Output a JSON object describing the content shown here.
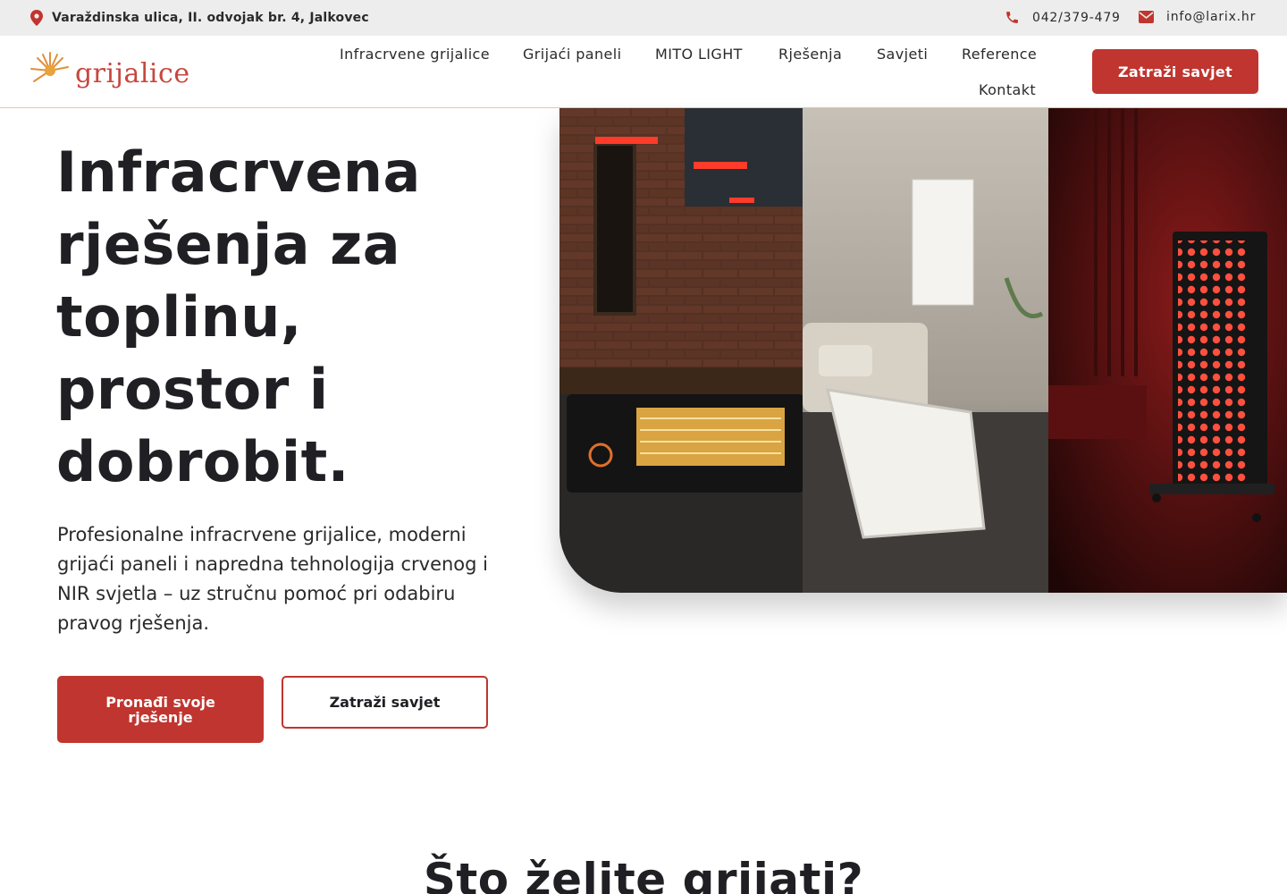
{
  "topbar": {
    "address": "Varaždinska ulica, II. odvojak br. 4, Jalkovec",
    "phone": "042/379-479",
    "email": "info@larix.hr",
    "icon_color": "#c0352f",
    "icons": [
      "map-pin-icon",
      "phone-icon",
      "envelope-icon"
    ]
  },
  "header": {
    "logo_text": "grijalice",
    "nav": [
      "Infracrvene grijalice",
      "Grijaći paneli",
      "MITO LIGHT",
      "Rješenja",
      "Savjeti",
      "Reference",
      "Kontakt"
    ],
    "cta_label": "Zatraži savjet"
  },
  "hero": {
    "title": "Infracrvena rješenja za toplinu, prostor i dobrobit.",
    "subtitle": "Profesionalne infracrvene grijalice, moderni grijaći paneli i napredna tehnologija crvenog i NIR svjetla – uz stručnu pomoć pri odabiru pravog rješenja.",
    "primary_button": "Pronađi svoje rješenje",
    "secondary_button": "Zatraži savjet",
    "image_panels": [
      "outdoor-terrace-heater",
      "indoor-white-panel",
      "red-light-therapy-panel"
    ]
  },
  "section": {
    "title": "Što želite grijati?"
  },
  "colors": {
    "accent": "#c0352f",
    "text": "#1f1f24",
    "topbar_bg": "#ededed"
  }
}
